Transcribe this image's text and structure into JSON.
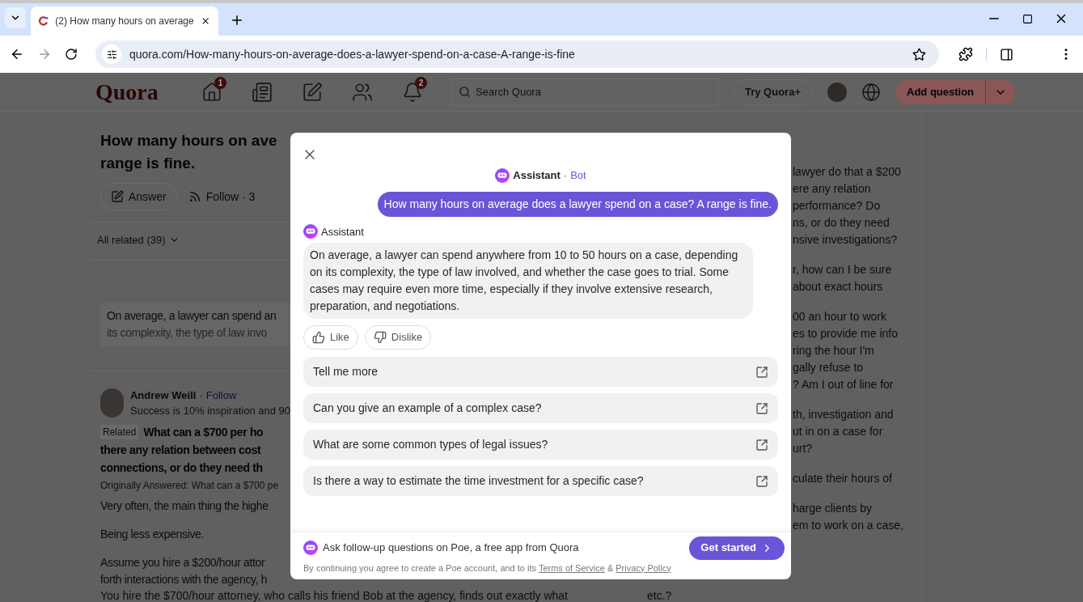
{
  "browser": {
    "tabs": [
      {
        "title": "(2) How many hours on average",
        "selected": true
      }
    ],
    "address": "quora.com/How-many-hours-on-average-does-a-lawyer-spend-on-a-case-A-range-is-fine"
  },
  "site_header": {
    "logo": "Quora",
    "nav": [
      {
        "kind": "home",
        "badge": "1"
      },
      {
        "kind": "list"
      },
      {
        "kind": "edit"
      },
      {
        "kind": "people"
      },
      {
        "kind": "bell",
        "badge": "2"
      }
    ],
    "search_placeholder": "Search Quora",
    "try_plus": "Try Quora+",
    "add_question": "Add question"
  },
  "question": {
    "title_lines": [
      "How many hours on ave",
      "range is fine."
    ],
    "actions": [
      "Answer",
      "Follow · 3"
    ],
    "filter": "All related (39)",
    "snippet_lines": [
      "On average, a lawyer can spend an",
      "its complexity, the type of law invo"
    ]
  },
  "answer": {
    "author": "Andrew Weill",
    "separator": "·",
    "follow": "Follow",
    "tagline": "Success is 10% inspiration and 90",
    "related_tag": "Related",
    "related_lines": [
      "What can a $700 per ho",
      "there any relation between cost",
      "connections, or do they need th"
    ],
    "originally": "Originally Answered: What can a $700 pe",
    "paragraphs": [
      [
        "Very often, the main thing the highe"
      ],
      [
        "Being less expensive."
      ],
      [
        "Assume you hire a $200/hour attor",
        "forth interactions with the agency, h"
      ]
    ],
    "last_line": "You hire the $700/hour attorney, who calls his friend Bob at the agency, finds out exactly what"
  },
  "right_column": {
    "paragraphs": [
      [
        "lawyer do that a $200",
        "ere any relation",
        "performance? Do",
        "ns, or do they need",
        "nsive investigations?"
      ],
      [
        "r, how can I be sure",
        "about exact hours"
      ],
      [
        "00 an hour to work",
        "es to provide me info",
        "ring the hour I'm",
        "gally refuse to",
        "? Am I out of line for"
      ],
      [
        "th, investigation and",
        "ut in on a case for",
        "urt?"
      ],
      [
        "culate their hours of"
      ],
      [
        "harge clients by",
        "em to work on a case,"
      ]
    ],
    "last_line": "etc.?"
  },
  "dialog": {
    "bot_name": "Assistant",
    "separator": "·",
    "bot_tag": "Bot",
    "question": "How many hours on average does a lawyer spend on a case? A range is fine.",
    "answer_label": "Assistant",
    "answer": "On average, a lawyer can spend anywhere from 10 to 50 hours on a case, depending on its complexity, the type of law involved, and whether the case goes to trial. Some cases may require even more time, especially if they involve extensive research, preparation, and negotiations.",
    "reactions": [
      {
        "kind": "like",
        "label": "Like"
      },
      {
        "kind": "dislike",
        "label": "Dislike"
      }
    ],
    "suggestions": [
      "Tell me more",
      "Can you give an example of a complex case?",
      "What are some common types of legal issues?",
      "Is there a way to estimate the time investment for a specific case?"
    ],
    "footer_text": "Ask follow-up questions on Poe, a free app from Quora",
    "cta": "Get started",
    "terms_prefix": "By continuing you agree to create a Poe account, and to its",
    "terms_link": "Terms of Service",
    "terms_join": "&",
    "privacy_link": "Privacy Policy"
  }
}
